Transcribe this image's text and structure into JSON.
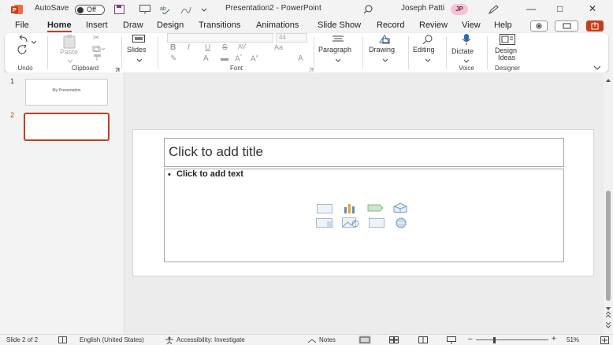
{
  "titlebar": {
    "autosave_label": "AutoSave",
    "autosave_state": "Off",
    "doc_title": "Presentation2  -  PowerPoint",
    "user_name": "Joseph Patti",
    "user_initials": "JP",
    "brand_color": "#c43e1c"
  },
  "tabs": [
    "File",
    "Home",
    "Insert",
    "Draw",
    "Design",
    "Transitions",
    "Animations",
    "Slide Show",
    "Record",
    "Review",
    "View",
    "Help"
  ],
  "active_tab": "Home",
  "ribbon": {
    "undo_group": "Undo",
    "paste_label": "Paste",
    "clipboard_group": "Clipboard",
    "slides_label": "Slides",
    "font_group": "Font",
    "font_size_value": "44",
    "font_name_value": "",
    "paragraph_label": "Paragraph",
    "drawing_label": "Drawing",
    "editing_label": "Editing",
    "dictate_label": "Dictate",
    "voice_group": "Voice",
    "design_ideas_line1": "Design",
    "design_ideas_line2": "Ideas",
    "designer_group": "Designer"
  },
  "thumbnails": [
    {
      "number": "1",
      "title": "My Presentation",
      "subtitle": "...."
    },
    {
      "number": "2",
      "title": "",
      "subtitle": ""
    }
  ],
  "slide": {
    "title_placeholder": "Click to add title",
    "body_placeholder": "Click to add text",
    "bullet": "•"
  },
  "statusbar": {
    "slide_info": "Slide 2 of 2",
    "language": "English (United States)",
    "accessibility": "Accessibility: Investigate",
    "notes": "Notes",
    "zoom": "51%"
  }
}
